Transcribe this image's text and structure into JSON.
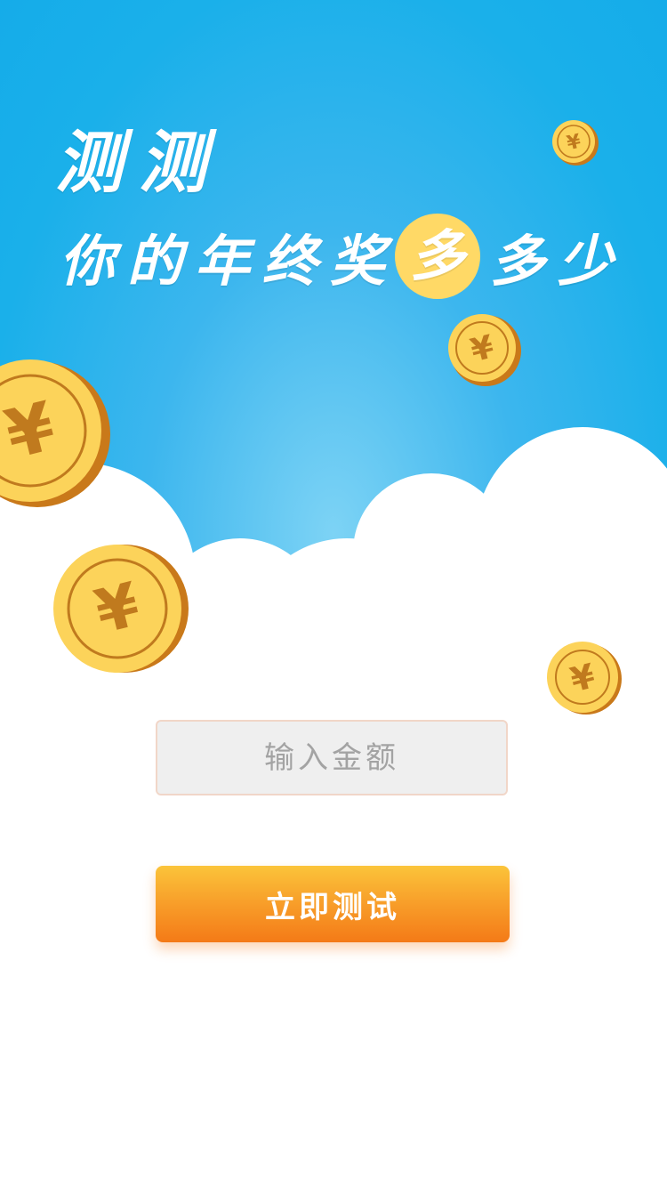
{
  "headline": {
    "line1": "测测",
    "line2_before": [
      "你",
      "的",
      "年",
      "终",
      "奖"
    ],
    "line2_highlight": "多",
    "line2_after": [
      "多",
      "少"
    ]
  },
  "form": {
    "amount_placeholder": "输入金额",
    "submit_label": "立即测试"
  },
  "icons": {
    "coin": "yuan-coin-icon",
    "currency_symbol": "¥"
  },
  "colors": {
    "sky": "#1ab0ea",
    "coin_face": "#fcd35a",
    "coin_edge": "#c9791a",
    "coin_symbol": "#c07a1e",
    "button_top": "#fbc43a",
    "button_bottom": "#f47a17",
    "highlight_circle": "#ffd966"
  }
}
